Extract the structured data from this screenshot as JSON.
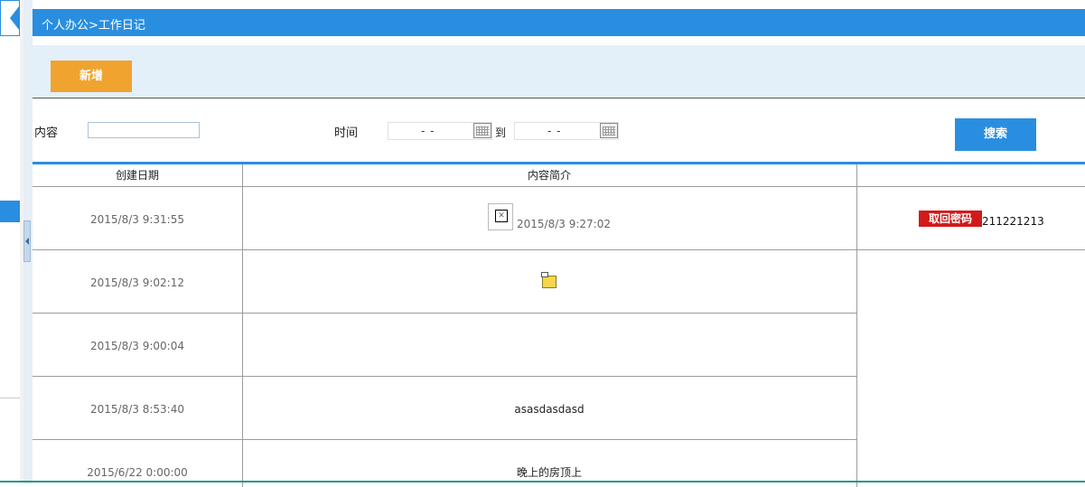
{
  "breadcrumb": "个人办公>工作日记",
  "toolbar": {
    "add_label": "新增"
  },
  "search": {
    "content_label": "内容",
    "content_value": "",
    "time_label": "时间",
    "date_from": "- -",
    "to_label": "到",
    "date_to": "- -",
    "search_label": "搜索"
  },
  "table": {
    "headers": [
      "创建日期",
      "内容简介",
      ""
    ],
    "rows": [
      {
        "date": "2015/8/3 9:31:55",
        "content": "2015/8/3 9:27:02"
      },
      {
        "date": "2015/8/3 9:02:12",
        "content": ""
      },
      {
        "date": "2015/8/3 9:00:04",
        "content": ""
      },
      {
        "date": "2015/8/3 8:53:40",
        "content": "asasdasdasd"
      },
      {
        "date": "2015/6/22 0:00:00",
        "content": "晚上的房顶上"
      }
    ]
  },
  "badge": {
    "label": "取回密码",
    "text": "211221213"
  },
  "colors": {
    "accent": "#2a8ee0",
    "add_button": "#f0a32f",
    "badge": "#d21a1a"
  }
}
